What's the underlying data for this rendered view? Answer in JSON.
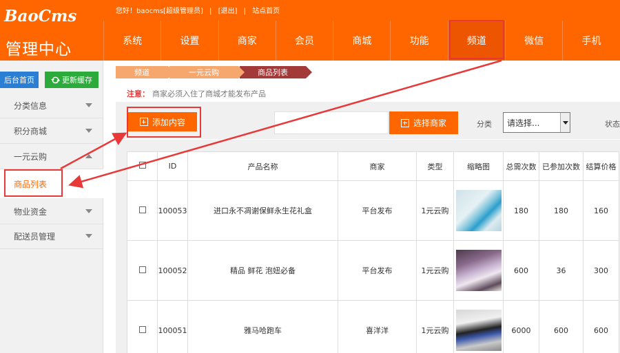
{
  "brand": {
    "logo_en": "BaoCms",
    "logo_cn": "管理中心"
  },
  "userbar": {
    "greeting": "您好！baocms[超级管理员]",
    "sep1": "|",
    "logout": "[退出]",
    "sep2": "|",
    "site_home": "站点首页"
  },
  "nav": {
    "items": [
      "系统",
      "设置",
      "商家",
      "会员",
      "商城",
      "功能",
      "频道",
      "微信",
      "手机"
    ],
    "active": "频道"
  },
  "sidebar": {
    "home_button": "后台首页",
    "refresh_button": "更新缓存",
    "items": [
      "分类信息",
      "积分商城",
      "一元云购",
      "物业资金",
      "配送员管理"
    ],
    "active_sub": "商品列表"
  },
  "breadcrumb": [
    "频道",
    "一元云购",
    "商品列表"
  ],
  "notice": {
    "label": "注意：",
    "text": "商家必须入住了商城才能发布产品"
  },
  "toolbar": {
    "add_button": "添加内容",
    "search_value": "",
    "select_merchant_button": "选择商家",
    "category_label": "分类",
    "category_value": "请选择...",
    "status_label": "状态"
  },
  "table": {
    "headers": [
      "ID",
      "产品名称",
      "商家",
      "类型",
      "缩略图",
      "总需次数",
      "已参加次数",
      "结算价格"
    ],
    "rows": [
      {
        "id": "100053",
        "name": "进口永不凋谢保鲜永生花礼盒",
        "merchant": "平台发布",
        "type": "1元云购",
        "thumb": "flower-box-image",
        "total": "180",
        "joined": "180",
        "price": "160"
      },
      {
        "id": "100052",
        "name": "精品 鲜花 泡妞必备",
        "merchant": "平台发布",
        "type": "1元云购",
        "thumb": "bouquet-image",
        "total": "600",
        "joined": "36",
        "price": "300"
      },
      {
        "id": "100051",
        "name": "雅马哈跑车",
        "merchant": "喜洋洋",
        "type": "1元云购",
        "thumb": "motorcycle-image",
        "total": "6000",
        "joined": "600",
        "price": "600"
      }
    ]
  },
  "colors": {
    "brand_orange": "#ff6600",
    "nav_active": "#ee5500",
    "annotation_red": "#e83838",
    "home_blue": "#2a7fd4",
    "refresh_green": "#2daa3c"
  }
}
